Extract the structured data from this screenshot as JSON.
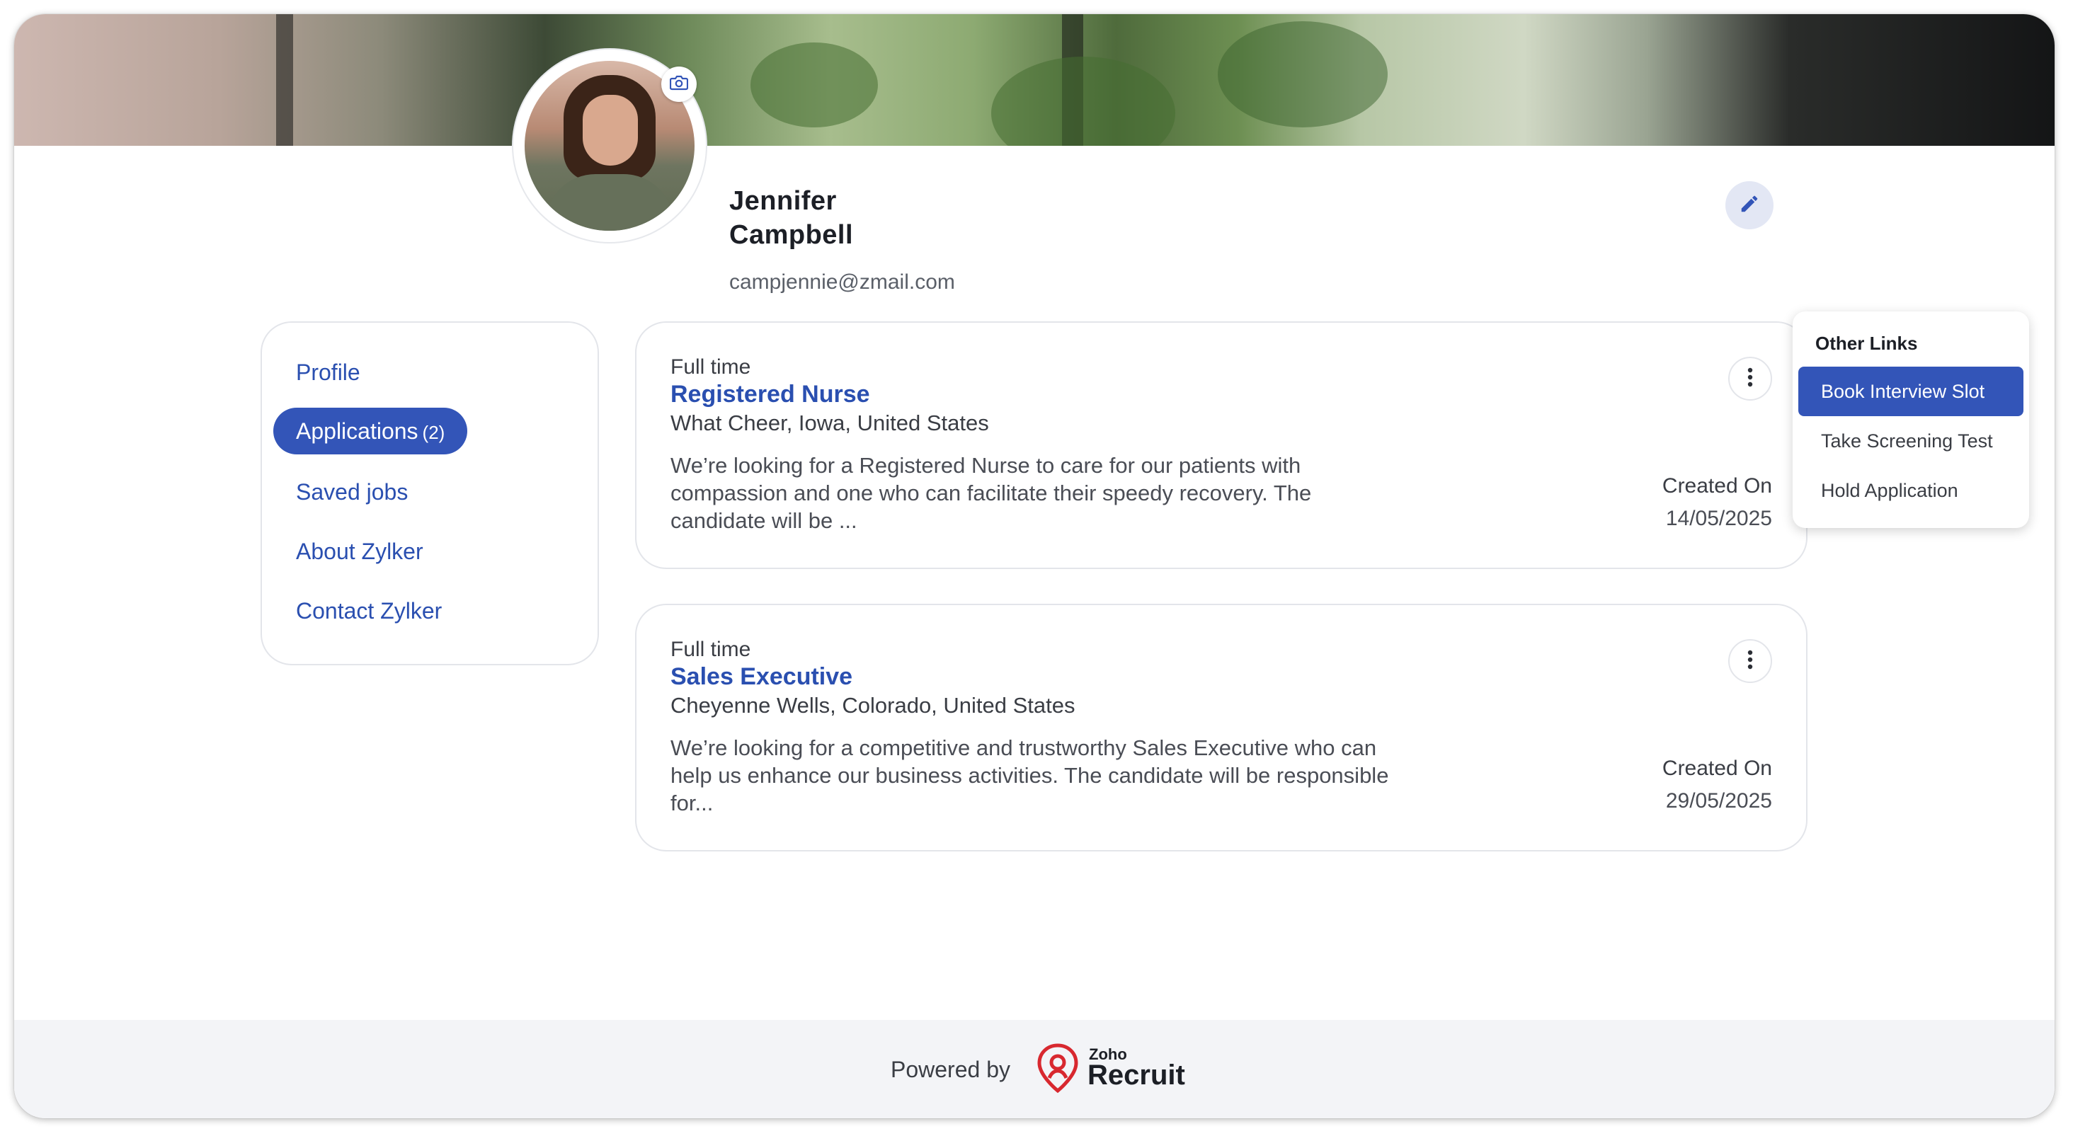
{
  "profile": {
    "first_name": "Jennifer",
    "last_name": "Campbell",
    "email": "campjennie@zmail.com"
  },
  "nav": {
    "items": [
      {
        "label": "Profile",
        "active": false
      },
      {
        "label": "Applications",
        "count": "(2)",
        "active": true
      },
      {
        "label": "Saved jobs",
        "active": false
      },
      {
        "label": "About Zylker",
        "active": false
      },
      {
        "label": "Contact Zylker",
        "active": false
      }
    ]
  },
  "applications": [
    {
      "type": "Full time",
      "title": "Registered Nurse",
      "location": "What Cheer, Iowa, United States",
      "description": "We’re looking for a Registered Nurse to care for our patients with compassion and one who can facilitate their speedy recovery. The candidate will be ...",
      "created_label": "Created On",
      "created_date": "14/05/2025"
    },
    {
      "type": "Full time",
      "title": "Sales Executive",
      "location": "Cheyenne Wells, Colorado, United States",
      "description": "We’re looking for a competitive and trustworthy Sales Executive who can help us enhance our business activities. The candidate will be responsible for...",
      "created_label": "Created On",
      "created_date": "29/05/2025"
    }
  ],
  "dropdown": {
    "header": "Other Links",
    "options": [
      "Book Interview Slot",
      "Take Screening Test",
      "Hold Application"
    ],
    "active_index": 0
  },
  "footer": {
    "powered_by": "Powered by",
    "logo_top": "Zoho",
    "logo_bottom": "Recruit"
  },
  "colors": {
    "accent": "#3355b8",
    "link": "#2a4fb0",
    "logo_red": "#d8282f"
  },
  "icons": {
    "camera": "camera-icon",
    "edit": "pencil-icon",
    "more": "vertical-ellipsis-icon",
    "logo": "zoho-recruit-logo"
  }
}
